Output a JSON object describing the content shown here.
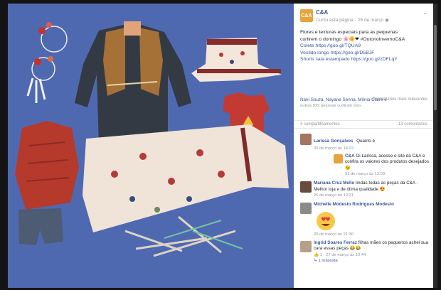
{
  "post": {
    "page_name": "C&A",
    "logo_text": "C&A",
    "meta_page": "Curtiu esta página",
    "meta_date": "26 de março",
    "lines": [
      "Flores e texturas especiais para as pequenas",
      "curtirem o domingo 🌸🌼❤ #OutonoInvernoC&A",
      "Colete https://goo.gl/TQUA9",
      "Vestido longo https://goo.gl/D5BJF",
      "Shorts saia estampado https://goo.gl/zDFLqY"
    ],
    "likers": "Nani Souza, Nayane Senna, Mônia Claire e",
    "likers_more": "outras 929 pessoas curtiram isso",
    "relevance": "Comentários mais relevantes",
    "shares": "4 compartilhamentos",
    "comments_count": "13 comentários"
  },
  "comments": [
    {
      "name": "Larissa Gonçalves",
      "text": "Quanto é",
      "date": "30 de março às 14:22"
    },
    {
      "name": "C&A",
      "text": "Oi Larissa, acesse o site da C&A e confira os valores dos produtos desejados 😉",
      "date": "31 de março às 13:09"
    },
    {
      "name": "Mariana Cruz Mello",
      "text": "lindas todas as peças da C&A - Melhor loja e de ótima qualidade 😍",
      "date": "26 de março às 10:21"
    },
    {
      "name": "Michelle Modesto",
      "text": "Rodrigues Modesto",
      "date": "26 de março às 21:30"
    },
    {
      "name": "Ingrid Soares Ferraz",
      "text": "filhas mães os pequenos achei sua cara essas peças 😂😂",
      "date": "27 de março às 10:44"
    }
  ],
  "replies_label": "1 resposta",
  "reply_likes": "1",
  "colors": {
    "link": "#365899",
    "photo_bg": "#4f69b1",
    "logo": "#e7a33c"
  }
}
